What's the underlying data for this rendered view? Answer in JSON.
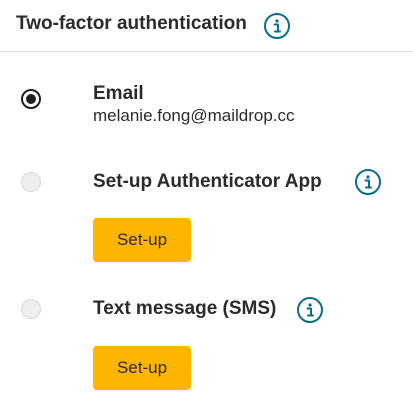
{
  "header": {
    "title": "Two-factor authentication",
    "info_icon": "info-icon"
  },
  "options": [
    {
      "title": "Email",
      "subtitle": "melanie.fong@maildrop.cc",
      "selected": true
    },
    {
      "title": "Set-up Authenticator App",
      "info_icon": "info-icon",
      "button_label": "Set-up",
      "selected": false
    },
    {
      "title": "Text message (SMS)",
      "info_icon": "info-icon",
      "button_label": "Set-up",
      "selected": false
    }
  ],
  "colors": {
    "accent_button": "#fdb500",
    "info_icon": "#0b6e86",
    "divider": "#dcdcdc"
  }
}
